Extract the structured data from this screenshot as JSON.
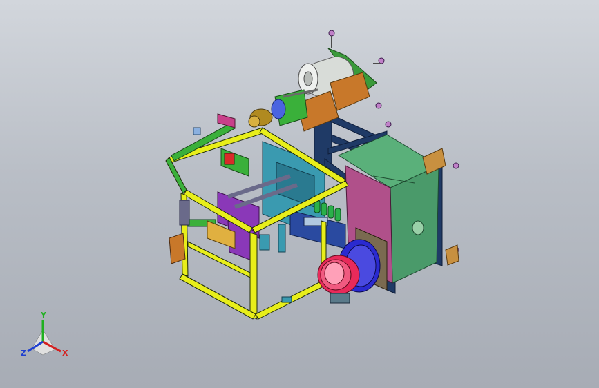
{
  "viewport": {
    "model": "assembly-3d-model",
    "background_top": "#d2d6dc",
    "background_bottom": "#a7acb5"
  },
  "triad": {
    "x_label": "X",
    "y_label": "Y",
    "z_label": "Z",
    "x_color": "#d42020",
    "y_color": "#20b020",
    "z_color": "#2040d0"
  },
  "palette": {
    "frame_yellow": "#e8ee1a",
    "frame_navy": "#1f3a66",
    "housing_green": "#4a9a6a",
    "housing_magenta": "#b0508a",
    "motor_silver": "#d8dcd8",
    "bracket_brown": "#c8782a",
    "block_purple": "#8a38b8",
    "bowl_red": "#e82a5a",
    "bowl_blue": "#2a2ad0",
    "rail_green": "#3ab03a",
    "plate_cyan": "#3a9ab0"
  }
}
